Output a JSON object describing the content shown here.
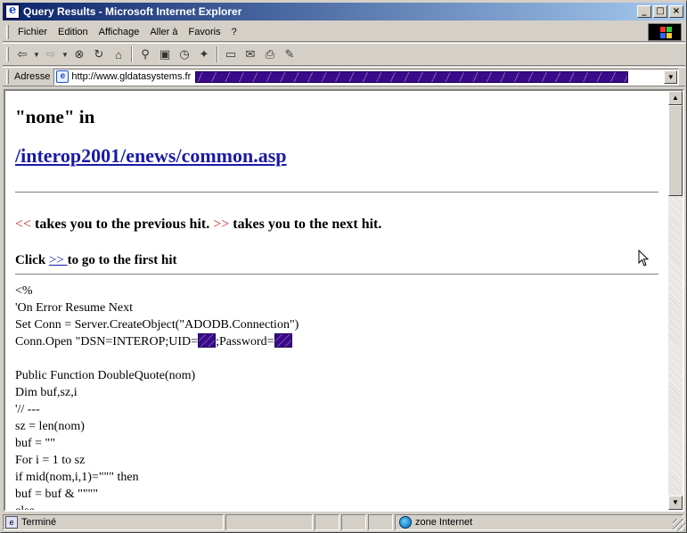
{
  "window": {
    "title": "Query Results - Microsoft Internet Explorer"
  },
  "menu": {
    "items": [
      "Fichier",
      "Edition",
      "Affichage",
      "Aller à",
      "Favoris",
      "?"
    ]
  },
  "toolbar": {
    "icons": [
      "back-arrow-icon",
      "forward-arrow-icon",
      "stop-icon",
      "refresh-icon",
      "home-icon",
      "search-icon",
      "favorites-icon",
      "history-icon",
      "channels-icon",
      "fullscreen-icon",
      "mail-icon",
      "print-icon",
      "edit-icon"
    ]
  },
  "address": {
    "label": "Adresse",
    "url": "http://www.gldatasystems.fr"
  },
  "page": {
    "heading": "\"none\" in",
    "file_link": "/interop2001/enews/common.asp",
    "nav_prev_arrow": "<<",
    "nav_prev_text": " takes you to the previous hit. ",
    "nav_next_arrow": ">>",
    "nav_next_text": " takes you to the next hit.",
    "click_prefix": "Click ",
    "click_link": ">> ",
    "click_suffix": "to go to the first hit",
    "code_lines": [
      "<%",
      "'On Error Resume Next",
      "Set Conn = Server.CreateObject(\"ADODB.Connection\")",
      "Conn.Open \"DSN=INTEROP;UID=",
      "",
      "Public Function DoubleQuote(nom)",
      "Dim buf,sz,i",
      "'// ---",
      "sz = len(nom)",
      "buf = \"\"",
      "For i = 1 to sz",
      "if mid(nom,i,1)=\"\"\" then",
      "buf = buf & \"\"\"\"",
      "else"
    ],
    "code_line4_mid": ";Password="
  },
  "status": {
    "text": "Terminé",
    "zone": "zone Internet"
  },
  "colors": {
    "titlebar_start": "#0a246a",
    "titlebar_end": "#a6caf0",
    "link": "#1a1aa6",
    "arrow": "#d02020",
    "redaction": "#3a0a8a"
  }
}
